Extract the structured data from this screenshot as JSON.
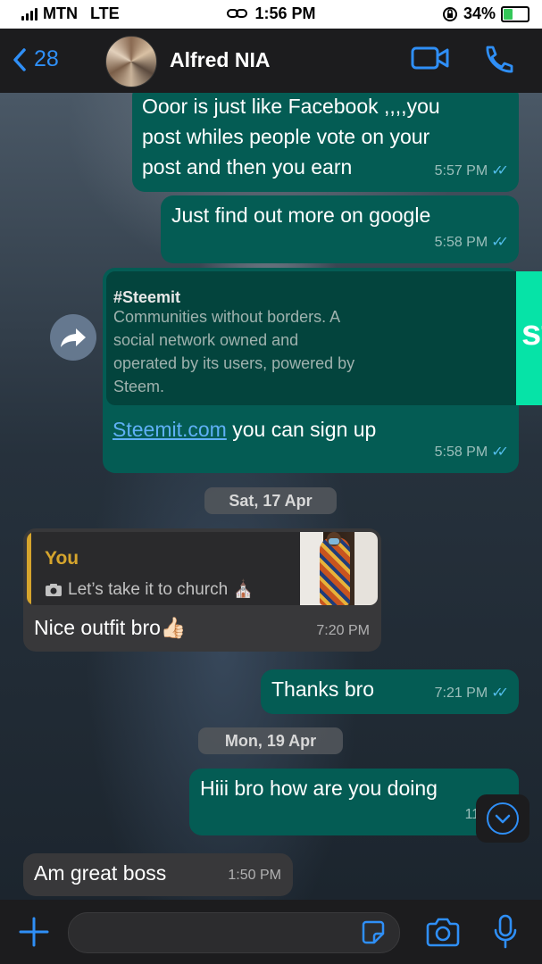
{
  "status": {
    "carrier": "MTN",
    "network": "LTE",
    "time": "1:56 PM",
    "battery": "34%",
    "battery_level": 0.34
  },
  "header": {
    "back_count": "28",
    "contact_name": "Alfred NIA"
  },
  "messages": {
    "m1": {
      "text_lines": [
        "Ooor is just like Facebook ,,,,you",
        "post whiles people vote on your",
        "post and then you earn"
      ],
      "time": "5:57 PM"
    },
    "m2": {
      "text": "Just find out more on google",
      "time": "5:58 PM"
    },
    "m3": {
      "preview_title": "#Steemit",
      "preview_desc_lines": [
        "Communities without borders. A",
        "social network owned and",
        "operated by its users, powered by",
        "Steem."
      ],
      "preview_image_text": "steem",
      "link": "Steemit.com",
      "text": " you can sign up",
      "time": "5:58 PM"
    },
    "date1": "Sat, 17 Apr",
    "m4": {
      "reply_author": "You",
      "reply_text": "Let’s take it to church ⛪",
      "text": "Nice outfit bro👍🏻",
      "time": "7:20 PM"
    },
    "m5": {
      "text": "Thanks bro",
      "time": "7:21 PM"
    },
    "date2": "Mon, 19 Apr",
    "m6": {
      "text": "Hiii bro how are you doing",
      "time": "11:49 AM"
    },
    "m7": {
      "text": "Am great boss",
      "time": "1:50 PM"
    }
  },
  "colors": {
    "outgoing": "#045c54",
    "incoming": "#38383a",
    "accent": "#2f8ff7",
    "read_ticks": "#53bdeb",
    "reply_accent": "#d6a52d"
  },
  "icons": [
    "signal-icon",
    "hotspot-icon",
    "rotation-lock-icon",
    "battery-icon",
    "back-chevron-icon",
    "video-call-icon",
    "phone-call-icon",
    "forward-icon",
    "camera-small-icon",
    "scroll-down-icon",
    "plus-icon",
    "sticker-icon",
    "camera-icon",
    "microphone-icon"
  ]
}
